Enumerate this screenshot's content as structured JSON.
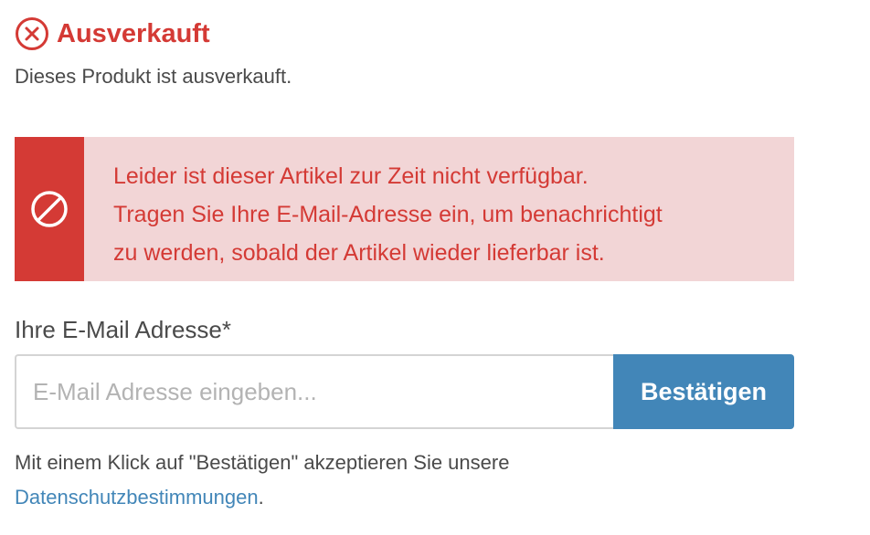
{
  "status": {
    "icon": "circle-x-icon",
    "title": "Ausverkauft",
    "description": "Dieses Produkt ist ausverkauft.",
    "color": "#d43a35"
  },
  "alert": {
    "icon": "ban-icon",
    "lines": [
      "Leider ist dieser Artikel zur Zeit nicht verfügbar.",
      "Tragen Sie Ihre E-Mail-Adresse ein, um benachrichtigt",
      "zu werden, sobald der Artikel wieder lieferbar ist."
    ],
    "background": "#f2d5d6",
    "accent": "#d43a35"
  },
  "form": {
    "label": "Ihre E-Mail Adresse*",
    "input_value": "",
    "input_placeholder": "E-Mail Adresse eingeben...",
    "submit_label": "Bestätigen",
    "button_color": "#4286b8"
  },
  "consent": {
    "text": "Mit einem Klick auf \"Bestätigen\" akzeptieren Sie unsere",
    "link_label": "Datenschutzbestimmungen",
    "suffix": "."
  }
}
